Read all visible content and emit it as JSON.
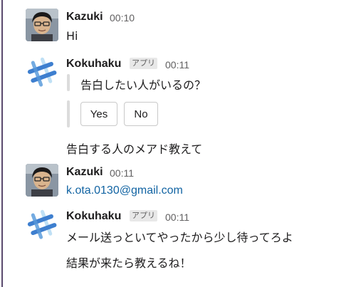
{
  "messages": [
    {
      "author": "Kazuki",
      "time": "00:10",
      "avatar_icon": "user-photo-icon",
      "lines": [
        "Hi"
      ]
    },
    {
      "author": "Kokuhaku",
      "badge": "アプリ",
      "time": "00:11",
      "avatar_icon": "bot-logo-icon",
      "attachment_text": "告白したい人がいるの？",
      "buttons": [
        "Yes",
        "No"
      ],
      "followup": "告白する人のメアド教えて"
    },
    {
      "author": "Kazuki",
      "time": "00:11",
      "avatar_icon": "user-photo-icon",
      "link": "k.ota.0130@gmail.com"
    },
    {
      "author": "Kokuhaku",
      "badge": "アプリ",
      "time": "00:11",
      "avatar_icon": "bot-logo-icon",
      "lines": [
        "メール送っといてやったから少し待ってろよ",
        "結果が来たら教えるね！"
      ]
    }
  ],
  "colors": {
    "link": "#1264a3",
    "bot_logo_blue": "#3e7fcf",
    "bot_logo_light": "#bfe0f5",
    "left_rule": "#5a4a6e"
  }
}
